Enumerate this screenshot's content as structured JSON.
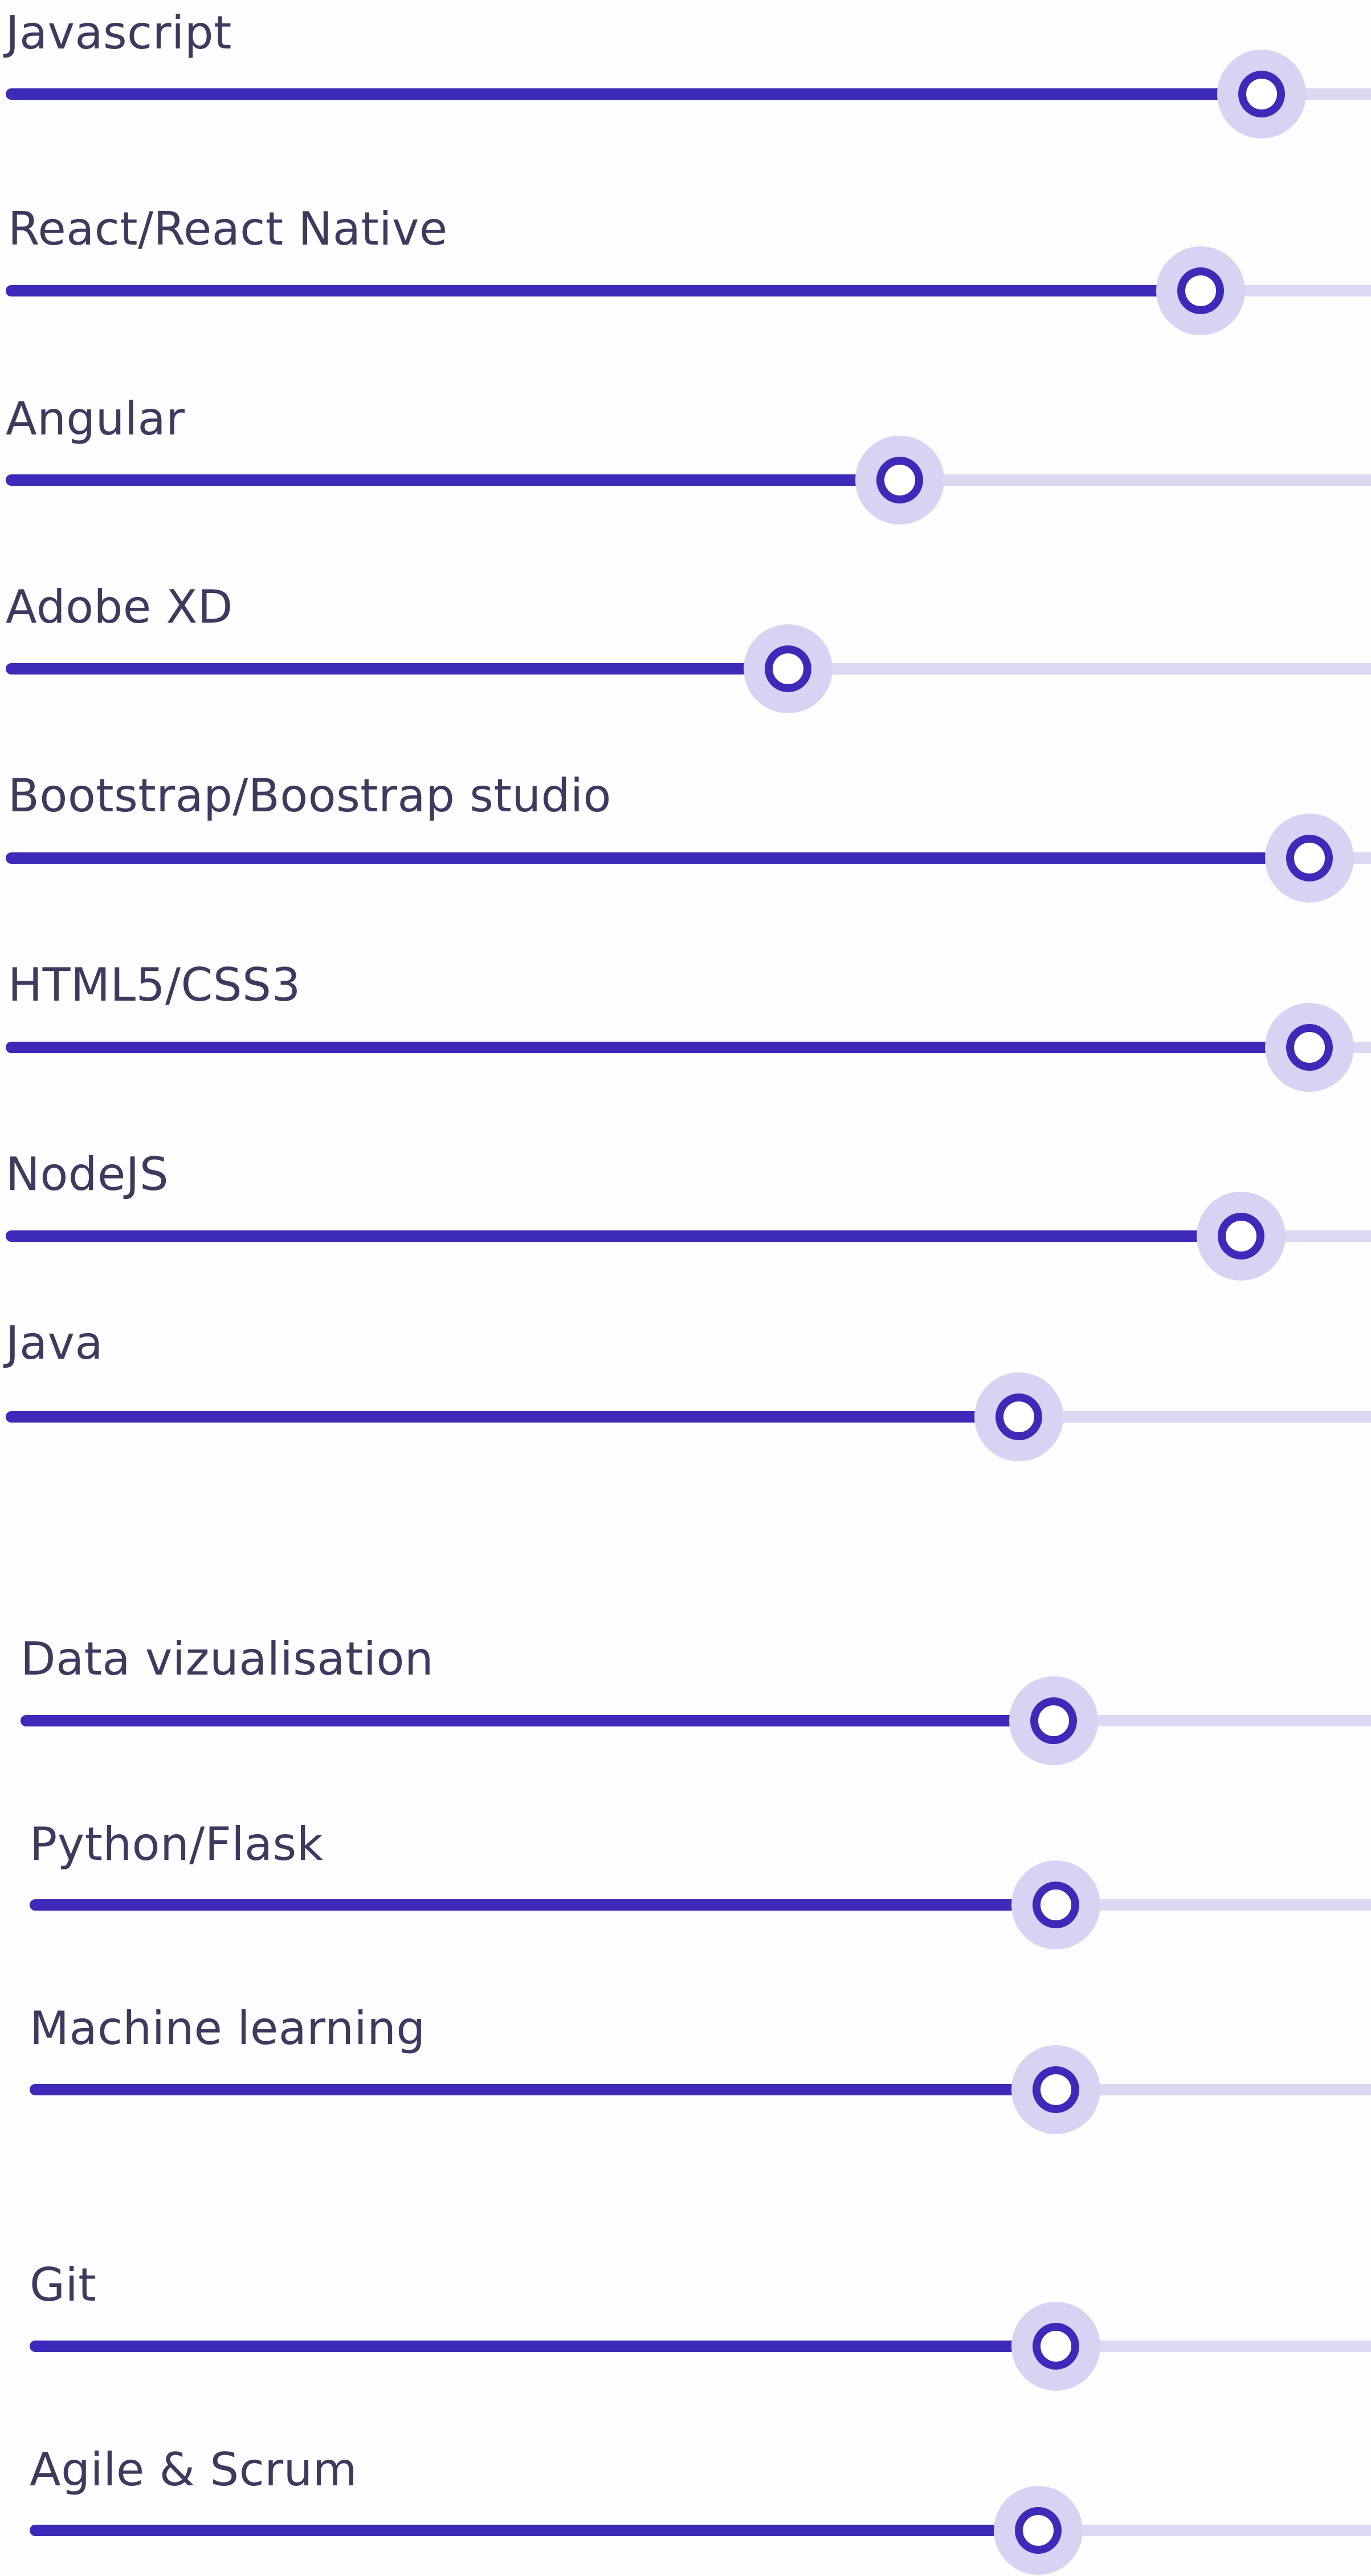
{
  "accent_color": "#3d2ab8",
  "track_color": "#dcd8f2",
  "groups": [
    {
      "name": "group-1",
      "skills": [
        {
          "label": "Javascript",
          "value": 0.92
        },
        {
          "label": "React/React Native",
          "value": 0.875
        },
        {
          "label": "Angular",
          "value": 0.655
        },
        {
          "label": "Adobe XD",
          "value": 0.573
        },
        {
          "label": "Bootstrap/Boostrap studio",
          "value": 0.955
        },
        {
          "label": "HTML5/CSS3",
          "value": 0.955
        },
        {
          "label": "NodeJS",
          "value": 0.905
        },
        {
          "label": "Java",
          "value": 0.742
        }
      ]
    },
    {
      "name": "group-2",
      "skills": [
        {
          "label": "Data vizualisation",
          "value": 0.765
        },
        {
          "label": "Python/Flask",
          "value": 0.765
        },
        {
          "label": "Machine learning",
          "value": 0.765
        }
      ]
    },
    {
      "name": "group-3",
      "skills": [
        {
          "label": "Git",
          "value": 0.765
        },
        {
          "label": "Agile & Scrum",
          "value": 0.752
        }
      ]
    }
  ]
}
